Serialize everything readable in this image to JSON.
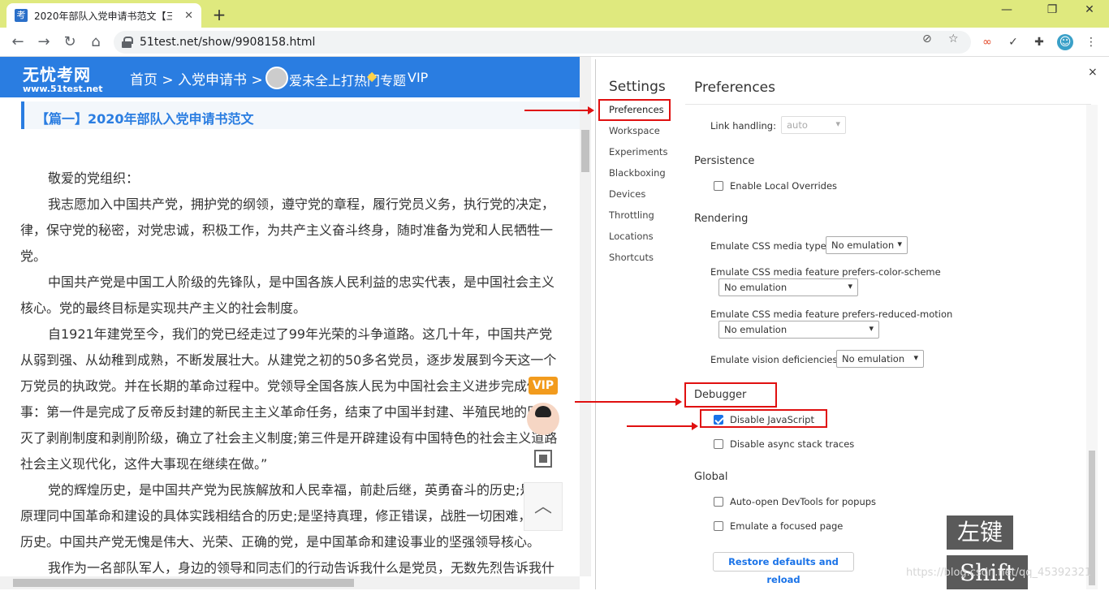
{
  "browser": {
    "tab_title": "2020年部队入党申请书范文【三",
    "tab_favicon": "考",
    "url": "51test.net/show/9908158.html"
  },
  "site": {
    "logo_cn": "无忧考网",
    "logo_en": "www.51test.net",
    "breadcrumb": "首页 > 入党申请书 >",
    "nav_overlap": "爱未全上打热门专题",
    "nav_vip": "VIP",
    "article_heading": "【篇一】2020年部队入党申请书范文",
    "vip_badge": "VIP",
    "paragraphs": [
      "敬爱的党组织：",
      "我志愿加入中国共产党，拥护党的纲领，遵守党的章程，履行党员义务，执行党的决定，",
      "律，保守党的秘密，对党忠诚，积极工作，为共产主义奋斗终身，随时准备为党和人民牺牲一",
      "党。",
      "中国共产党是中国工人阶级的先锋队，是中国各族人民利益的忠实代表，是中国社会主义",
      "核心。党的最终目标是实现共产主义的社会制度。",
      "自1921年建党至今，我们的党已经走过了99年光荣的斗争道路。这几十年，中国共产党",
      "从弱到强、从幼稚到成熟，不断发展壮大。从建党之初的50多名党员，逐步发展到今天这一个",
      "万党员的执政党。并在长期的革命过程中。党领导全国各族人民为中国社会主义进步完成做",
      "事：第一件是完成了反帝反封建的新民主主义革命任务，结束了中国半封建、半殖民地的历史",
      "灭了剥削制度和剥削阶级，确立了社会主义制度;第三件是开辟建设有中国特色的社会主义道路",
      "社会主义现代化，这件大事现在继续在做。”",
      "党的辉煌历史，是中国共产党为民族解放和人民幸福，前赴后继，英勇奋斗的历史;是马克",
      "原理同中国革命和建设的具体实践相结合的历史;是坚持真理，修正错误，战胜一切困难，不断",
      "历史。中国共产党无愧是伟大、光荣、正确的党，是中国革命和建设事业的坚强领导核心。",
      "我作为一名部队军人，身边的领导和同志们的行动告诉我什么是党员，无数先烈告诉我什"
    ]
  },
  "devtools": {
    "settings_title": "Settings",
    "close": "×",
    "nav": [
      "Preferences",
      "Workspace",
      "Experiments",
      "Blackboxing",
      "Devices",
      "Throttling",
      "Locations",
      "Shortcuts"
    ],
    "panel_title": "Preferences",
    "link_handling_label": "Link handling:",
    "link_handling_value": "auto",
    "persistence": "Persistence",
    "enable_local_overrides": "Enable Local Overrides",
    "rendering": "Rendering",
    "css_media_type_label": "Emulate CSS media type",
    "css_media_type_value": "No emulation",
    "color_scheme_label": "Emulate CSS media feature prefers-color-scheme",
    "color_scheme_value": "No emulation",
    "reduced_motion_label": "Emulate CSS media feature prefers-reduced-motion",
    "reduced_motion_value": "No emulation",
    "vision_label": "Emulate vision deficiencies",
    "vision_value": "No emulation",
    "debugger": "Debugger",
    "disable_js": "Disable JavaScript",
    "disable_async": "Disable async stack traces",
    "global": "Global",
    "auto_open": "Auto-open DevTools for popups",
    "emulate_focused": "Emulate a focused page",
    "restore": "Restore defaults and reload"
  },
  "overlay": {
    "key_left": "左键",
    "key_shift": "Shift",
    "watermark": "https://blog.csdn.net/qq_45392321"
  },
  "colors": {
    "chrome_tabbar": "#dfe97e",
    "site_blue": "#2a7de1",
    "annotation_red": "#e01010",
    "devtools_blue": "#1a73e8"
  }
}
